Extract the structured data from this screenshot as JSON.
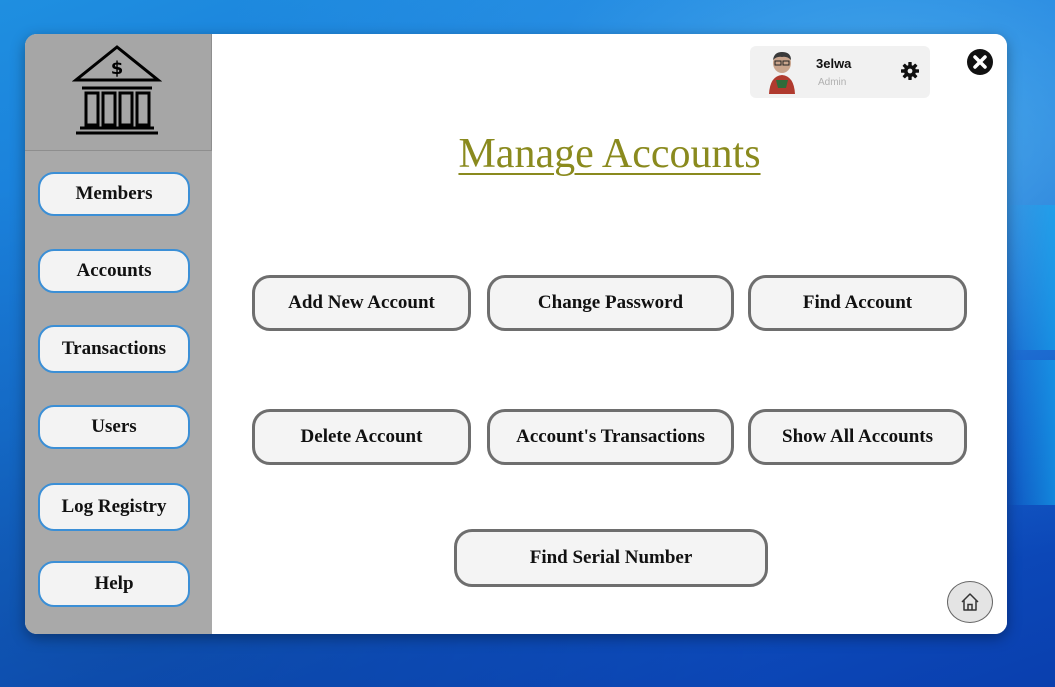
{
  "sidebar": {
    "logo_icon": "bank-icon",
    "items": [
      {
        "label": "Members"
      },
      {
        "label": "Accounts"
      },
      {
        "label": "Transactions"
      },
      {
        "label": "Users"
      },
      {
        "label": "Log Registry"
      },
      {
        "label": "Help"
      }
    ]
  },
  "user": {
    "name": "3elwa",
    "role": "Admin",
    "settings_icon": "gear-icon"
  },
  "window": {
    "close_icon": "close-icon",
    "home_icon": "home-icon"
  },
  "main": {
    "title": "Manage Accounts",
    "actions": {
      "add_new_account": "Add New Account",
      "change_password": "Change Password",
      "find_account": "Find Account",
      "delete_account": "Delete Account",
      "account_transactions": "Account's Transactions",
      "show_all_accounts": "Show All Accounts",
      "find_serial_number": "Find Serial Number"
    }
  },
  "colors": {
    "title": "#8a8a1e",
    "sidebar_bg": "#a9a9a9",
    "nav_border": "#3b8fd6",
    "action_border": "#6e6e6e"
  }
}
